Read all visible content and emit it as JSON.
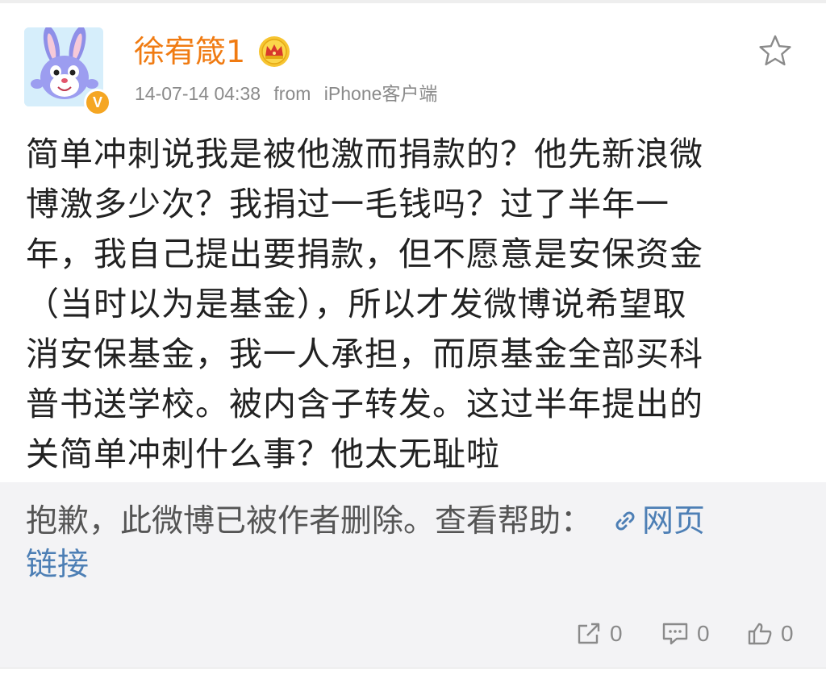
{
  "post": {
    "author": "徐宥箴1",
    "timestamp": "14-07-14 04:38",
    "from_label": "from",
    "source": "iPhone客户端",
    "verified_badge": "V",
    "lines": [
      "简单冲刺说我是被他激而捐款的？他先新浪微",
      "博激多少次？我捐过一毛钱吗？过了半年一",
      "年，我自己提出要捐款，但不愿意是安保资金",
      "（当时以为是基金），所以才发微博说希望取",
      "消安保基金，我一人承担，而原基金全部买科",
      "普书送学校。被内含子转发。这过半年提出的",
      "关简单冲刺什么事？他太无耻啦"
    ]
  },
  "repost": {
    "deleted_text": "抱歉，此微博已被作者删除。查看帮助：",
    "link_line1": "网页",
    "link_line2": "链接"
  },
  "actions": {
    "repost_count": "0",
    "comment_count": "0",
    "like_count": "0"
  },
  "icons": {
    "favorite": "star-icon",
    "crown": "crown-icon",
    "link": "link-icon",
    "repost": "share-icon",
    "comment": "comment-icon",
    "like": "thumbs-up-icon"
  },
  "colors": {
    "username": "#f07b12",
    "link": "#4d7fb5",
    "verified": "#f5a623",
    "repost_bg": "#f3f3f5"
  }
}
